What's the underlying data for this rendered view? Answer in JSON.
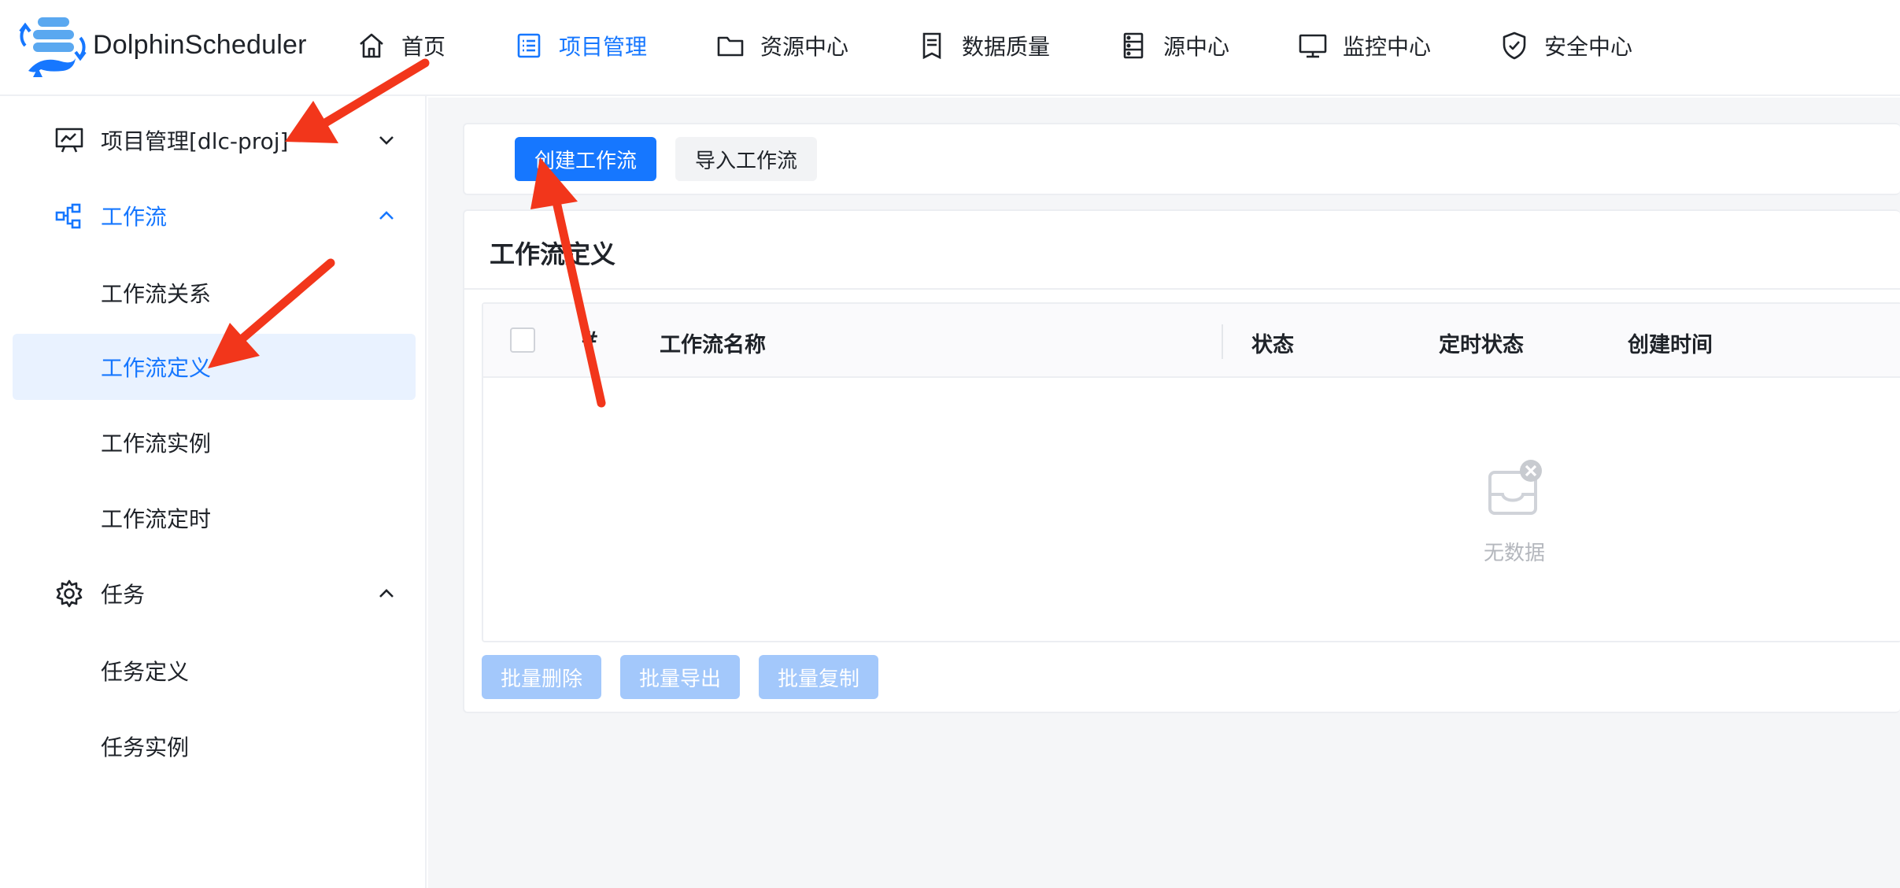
{
  "app": {
    "brand": "DolphinScheduler"
  },
  "topnav": {
    "items": [
      {
        "label": "首页",
        "icon": "home-icon"
      },
      {
        "label": "项目管理",
        "icon": "project-list-icon",
        "active": true
      },
      {
        "label": "资源中心",
        "icon": "folder-icon"
      },
      {
        "label": "数据质量",
        "icon": "data-quality-icon"
      },
      {
        "label": "源中心",
        "icon": "datasource-icon"
      },
      {
        "label": "监控中心",
        "icon": "monitor-icon"
      },
      {
        "label": "安全中心",
        "icon": "shield-icon"
      }
    ]
  },
  "sidebar": {
    "project": {
      "label": "项目管理[dlc-proj]",
      "icon": "presentation-icon",
      "expanded": false
    },
    "workflow": {
      "label": "工作流",
      "icon": "workflow-icon",
      "expanded": true,
      "items": [
        "工作流关系",
        "工作流定义",
        "工作流实例",
        "工作流定时"
      ],
      "selected": "工作流定义"
    },
    "task": {
      "label": "任务",
      "icon": "gear-icon",
      "expanded": true,
      "items": [
        "任务定义",
        "任务实例"
      ]
    }
  },
  "toolbar": {
    "create_label": "创建工作流",
    "import_label": "导入工作流"
  },
  "list": {
    "title": "工作流定义",
    "columns": [
      "#",
      "工作流名称",
      "状态",
      "定时状态",
      "创建时间"
    ],
    "empty_text": "无数据"
  },
  "bulk": {
    "delete_label": "批量删除",
    "export_label": "批量导出",
    "copy_label": "批量复制"
  },
  "colors": {
    "accent": "#1677ff",
    "selected_bg": "#e9f2ff",
    "disabled_btn": "#a3c8fb",
    "annotation_arrow": "#f2361b"
  }
}
